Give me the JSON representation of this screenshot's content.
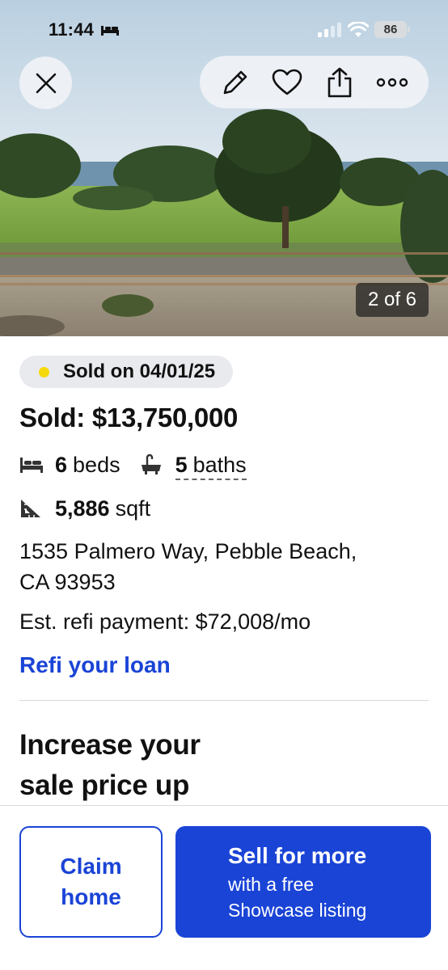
{
  "status_bar": {
    "time": "11:44",
    "battery": "86",
    "icons": [
      "bed-icon",
      "signal-icon",
      "wifi-icon",
      "battery-icon"
    ]
  },
  "toolbar": {
    "icons": [
      "close-icon",
      "pencil-icon",
      "heart-icon",
      "share-icon",
      "more-icon"
    ]
  },
  "photo": {
    "counter": "2 of 6"
  },
  "listing": {
    "status_badge": "Sold on 04/01/25",
    "status_dot_color": "#f5d90a",
    "price": "Sold: $13,750,000",
    "beds_count": "6",
    "beds_label": "beds",
    "baths_count": "5",
    "baths_label": "baths",
    "sqft_value": "5,886",
    "sqft_label": "sqft",
    "address_line1": "1535 Palmero Way, Pebble Beach,",
    "address_line2": "CA 93953",
    "refi_payment": "Est. refi payment: $72,008/mo",
    "refi_link": "Refi your loan",
    "icons": [
      "bed-icon",
      "bathtub-icon",
      "ruler-triangle-icon"
    ]
  },
  "promo": {
    "heading_line1": "Increase your",
    "heading_line2": "sale price up"
  },
  "bottom_bar": {
    "claim_line1": "Claim",
    "claim_line2": "home",
    "sell_main": "Sell for more",
    "sell_sub_line1": "with a free",
    "sell_sub_line2": "Showcase listing"
  },
  "colors": {
    "accent_blue": "#1a44d6",
    "badge_bg": "#e9eaee"
  }
}
